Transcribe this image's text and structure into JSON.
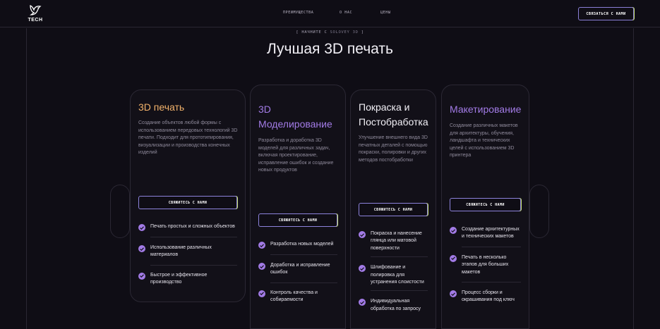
{
  "brand": {
    "logo_text": "TECH"
  },
  "nav": {
    "items": [
      "ПРЕИМУЩЕСТВА",
      "О НАС",
      "ЦЕНЫ"
    ]
  },
  "header": {
    "contact_label": "СВЯЗАТЬСЯ С НАМИ"
  },
  "hero": {
    "eyebrow_prefix": "[ НАЧНИТЕ С",
    "eyebrow_brand": "SOLOVEY 3D",
    "eyebrow_suffix": "]",
    "title": "Лучшая 3D печать"
  },
  "colors": {
    "accent_orange": "#f2b26b",
    "accent_purple": "#a27be6",
    "background": "#0f0d15"
  },
  "cards": [
    {
      "title": "3D печать",
      "description": "Создание объектов любой формы с использованием передовых технологий 3D печати. Подходит для прототипирования, визуализации и производства конечных изделий",
      "button": "СВЯЖИТЕСЬ С НАМИ",
      "features": [
        "Печать простых и сложных объектов",
        "Использование различных материалов",
        "Быстрое и эффективное производство"
      ]
    },
    {
      "title": "3D Моделирование",
      "description": "Разработка и доработка 3D моделей для различных задач, включая проектирование, исправление ошибок и создание новых продуктов",
      "button": "СВЯЖИТЕСЬ С НАМИ",
      "features": [
        "Разработка новых моделей",
        "Доработка и исправление ошибок",
        "Контроль качества и собираемости"
      ]
    },
    {
      "title": "Покраска и Постобработка",
      "description": "Улучшение внешнего вида 3D печатных деталей с помощью покраски, полировки и других методов постобработки",
      "button": "СВЯЖИТЕСЬ С НАМИ",
      "features": [
        "Покраска и нанесение глянца или матовой поверхности",
        "Шлифование и полировка для устранения слоистости",
        "Индивидуальная обработка по запросу"
      ]
    },
    {
      "title": "Макетирование",
      "description": "Создание различных макетов для архитектуры, обучения, ландшафта и технических целей с использованием 3D принтера",
      "button": "СВЯЖИТЕСЬ С НАМИ",
      "features": [
        "Создание архитектурных и технических макетов",
        "Печать в несколько этапов для больших макетов",
        "Процесс сборки и окрашивания под ключ"
      ]
    }
  ]
}
